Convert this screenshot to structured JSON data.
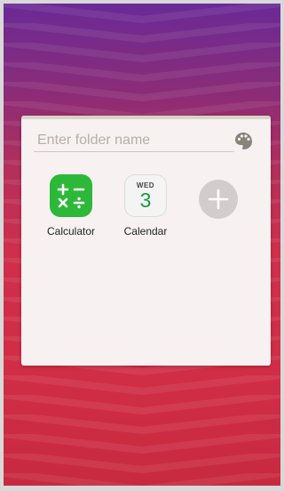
{
  "folder": {
    "name_placeholder": "Enter folder name",
    "name_value": "",
    "palette_icon": "palette-icon",
    "apps": [
      {
        "label": "Calculator",
        "icon": "calculator-icon",
        "color": "#2db83a"
      },
      {
        "label": "Calendar",
        "icon": "calendar-icon",
        "day": "WED",
        "date": "3",
        "color": "#1a9a3e"
      }
    ],
    "add_button_icon": "plus-icon"
  },
  "colors": {
    "wallpaper_top": "#6a2a96",
    "wallpaper_bottom": "#d12e46",
    "folder_background": "#f7f1f2"
  }
}
